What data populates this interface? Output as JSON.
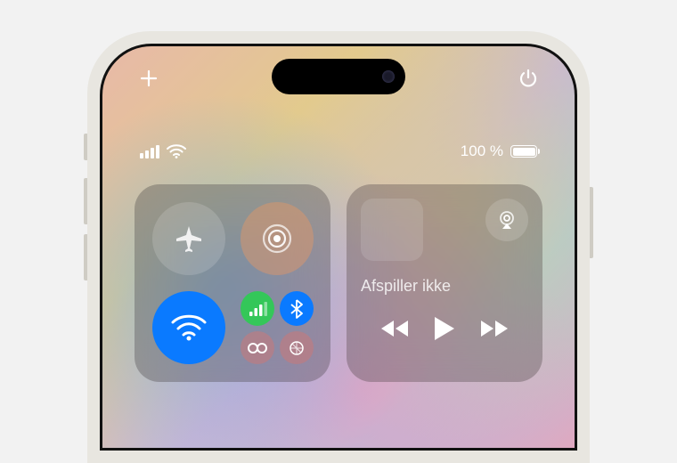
{
  "status": {
    "battery_text": "100 %",
    "battery_percent": 100,
    "cellular_bars": 4,
    "wifi_connected": true
  },
  "top_actions": {
    "add": "+",
    "power": "power"
  },
  "connectivity": {
    "airplane": {
      "active": false
    },
    "airdrop": {
      "active": false
    },
    "wifi": {
      "active": true
    },
    "cellular": {
      "active": true
    },
    "bluetooth": {
      "active": true
    },
    "hotspot": {
      "active": false
    },
    "satellite": {
      "active": false
    }
  },
  "media": {
    "status_text": "Afspiller ikke",
    "airplay_available": true
  }
}
